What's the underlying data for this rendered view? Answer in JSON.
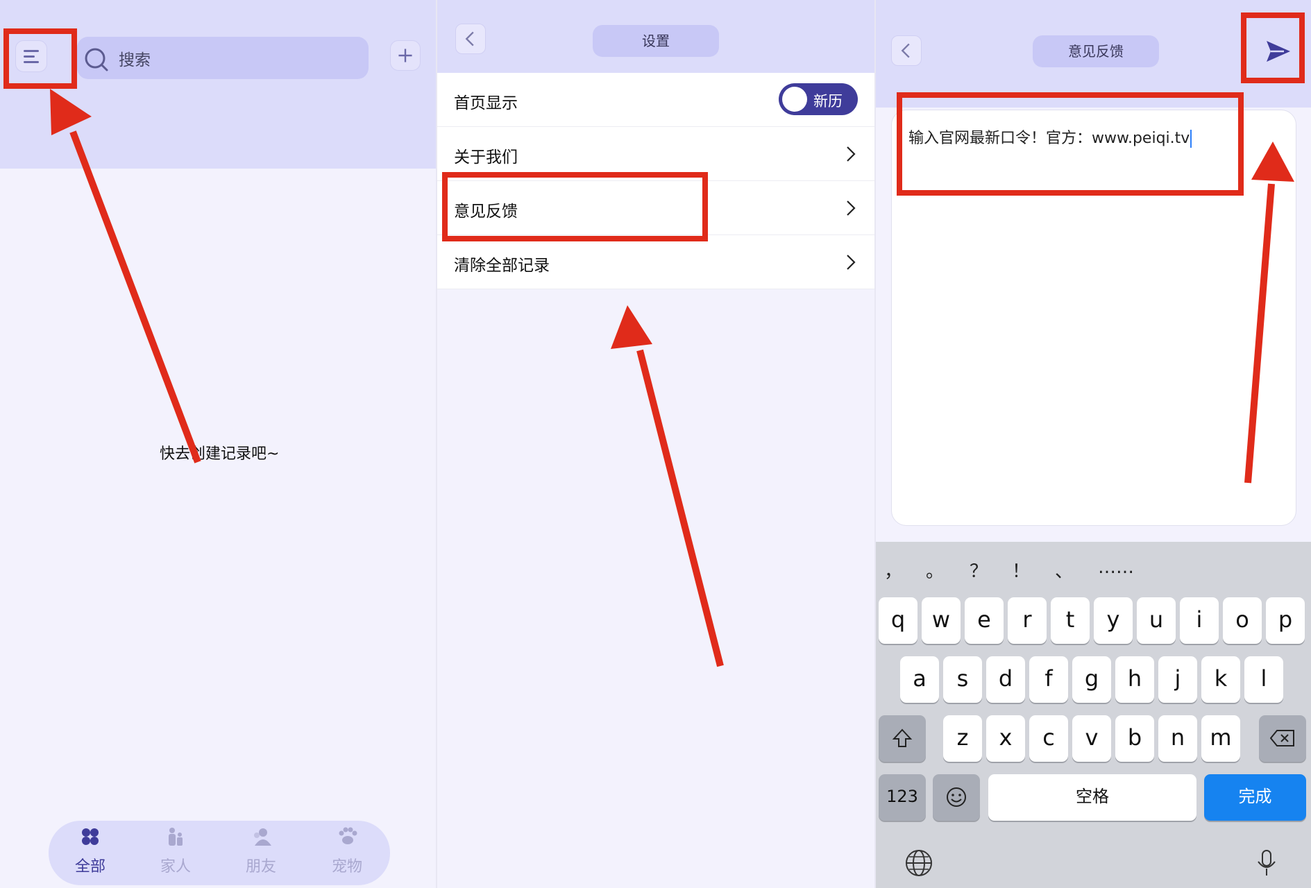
{
  "panel1": {
    "search": {
      "label": "搜索"
    },
    "empty_state": "快去创建记录吧~",
    "tabs": [
      {
        "label": "全部",
        "icon": "grid-icon",
        "active": true
      },
      {
        "label": "家人",
        "icon": "family-icon",
        "active": false
      },
      {
        "label": "朋友",
        "icon": "friends-icon",
        "active": false
      },
      {
        "label": "宠物",
        "icon": "paw-icon",
        "active": false
      }
    ]
  },
  "panel2": {
    "title": "设置",
    "rows": [
      {
        "label": "首页显示",
        "control": "toggle",
        "toggle_text": "新历"
      },
      {
        "label": "关于我们",
        "control": "chevron"
      },
      {
        "label": "意见反馈",
        "control": "chevron"
      },
      {
        "label": "清除全部记录",
        "control": "chevron"
      }
    ]
  },
  "panel3": {
    "title": "意见反馈",
    "feedback_text": "输入官网最新口令！官方：www.peiqi.tv",
    "keyboard": {
      "punctuation": [
        "，",
        "。",
        "？",
        "！",
        "、",
        "……"
      ],
      "row1": [
        "q",
        "w",
        "e",
        "r",
        "t",
        "y",
        "u",
        "i",
        "o",
        "p"
      ],
      "row2": [
        "a",
        "s",
        "d",
        "f",
        "g",
        "h",
        "j",
        "k",
        "l"
      ],
      "row3": [
        "z",
        "x",
        "c",
        "v",
        "b",
        "n",
        "m"
      ],
      "numbers_key": "123",
      "space_key": "空格",
      "done_key": "完成"
    }
  },
  "colors": {
    "accent": "#3f3c9a",
    "header_bg": "#dcdcfa",
    "annotation": "#e02b1a",
    "done_key": "#1683f0"
  }
}
